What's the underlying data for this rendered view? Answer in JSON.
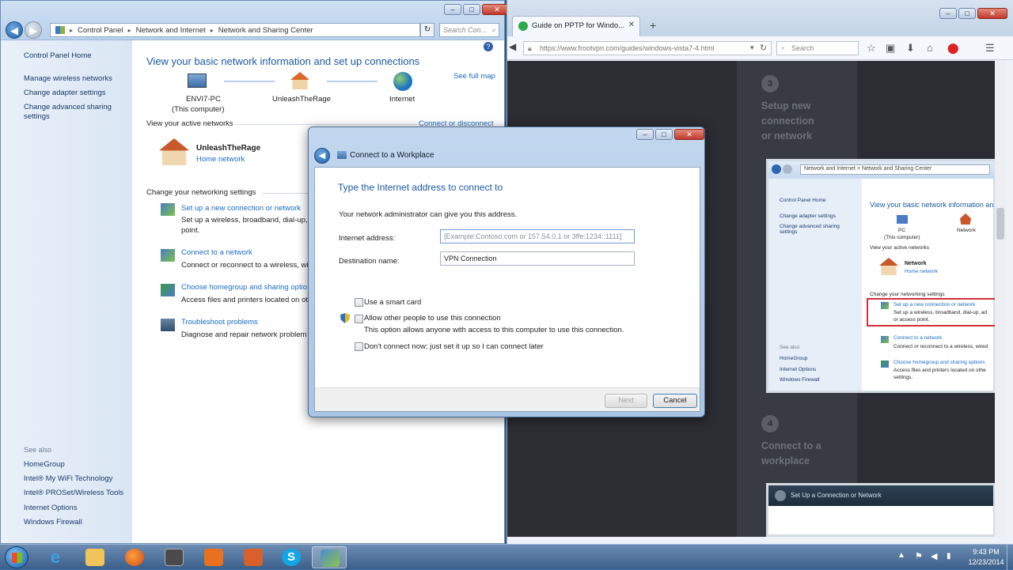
{
  "control_panel": {
    "breadcrumb": [
      "Control Panel",
      "Network and Internet",
      "Network and Sharing Center"
    ],
    "search_placeholder": "Search Con...",
    "left_links": [
      "Control Panel Home",
      "Manage wireless networks",
      "Change adapter settings",
      "Change advanced sharing settings"
    ],
    "see_also_label": "See also",
    "see_also": [
      "HomeGroup",
      "Intel® My WiFi Technology",
      "Intel® PROSet/Wireless Tools",
      "Internet Options",
      "Windows Firewall"
    ],
    "heading": "View your basic network information and set up connections",
    "see_full_map": "See full map",
    "map_nodes": [
      "ENVI7-PC",
      "(This computer)",
      "UnleashTheRage",
      "Internet"
    ],
    "active_networks_label": "View your active networks",
    "connect_disconnect": "Connect or disconnect",
    "active_network": {
      "name": "UnleashTheRage",
      "type": "Home network"
    },
    "change_settings_label": "Change your networking settings",
    "tasks": [
      {
        "title": "Set up a new connection or network",
        "desc": "Set up a wireless, broadband, dial-up,",
        "desc2": "point."
      },
      {
        "title": "Connect to a network",
        "desc": "Connect or reconnect to a wireless, wi"
      },
      {
        "title": "Choose homegroup and sharing optio",
        "desc": "Access files and printers located on ot"
      },
      {
        "title": "Troubleshoot problems",
        "desc": "Diagnose and repair network problem"
      }
    ]
  },
  "firefox": {
    "tab_title": "Guide on PPTP for Windo...",
    "url": "https://www.frootvpn.com/guides/windows-vista7-4.html",
    "search_placeholder": "Search",
    "steps": [
      {
        "num": "3",
        "line1": "Setup new",
        "line2": "connection",
        "line3": "or network"
      },
      {
        "num": "4",
        "line1": "Connect to a",
        "line2": "workplace"
      }
    ],
    "shot": {
      "breadcrumb": "Network and Internet > Network and Sharing Center",
      "left": [
        "Control Panel Home",
        "Change adapter settings",
        "Change advanced sharing settings"
      ],
      "see_also_label": "See also",
      "see_also": [
        "HomeGroup",
        "Internet Options",
        "Windows Firewall"
      ],
      "heading": "View your basic network information an",
      "pc": "PC",
      "pc_sub": "(This computer)",
      "network": "Network",
      "active": "View your active networks",
      "net_name": "Network",
      "net_type": "Home network",
      "change": "Change your networking settings",
      "t1": "Set up a new connection or network",
      "t1d": "Set up a wireless, broadband, dial-up, ad",
      "t1d2": "or access point.",
      "t2": "Connect to a network",
      "t2d": "Connect or reconnect to a wireless, wired",
      "t3": "Choose homegroup and sharing options",
      "t3d": "Access files and printers located on othe",
      "t3d2": "settings.",
      "second_title": "Set Up a Connection or Network"
    }
  },
  "dialog": {
    "title": "Connect to a Workplace",
    "heading": "Type the Internet address to connect to",
    "intro": "Your network administrator can give you this address.",
    "addr_label": "Internet address:",
    "addr_placeholder": "[Example:Contoso.com or 157.54.0.1 or 3ffe:1234::1111]",
    "dest_label": "Destination name:",
    "dest_value": "VPN Connection",
    "smart_card": "Use a smart card",
    "allow_others": "Allow other people to use this connection",
    "allow_note": "This option allows anyone with access to this computer to use this connection.",
    "dont_connect": "Don't connect now; just set it up so I can connect later",
    "next": "Next",
    "cancel": "Cancel"
  },
  "taskbar": {
    "time": "9:43 PM",
    "date": "12/23/2014"
  },
  "colors": {
    "link": "#1a6bc4",
    "heading": "#1c5aa1",
    "ff_page": "#2b2d33"
  }
}
